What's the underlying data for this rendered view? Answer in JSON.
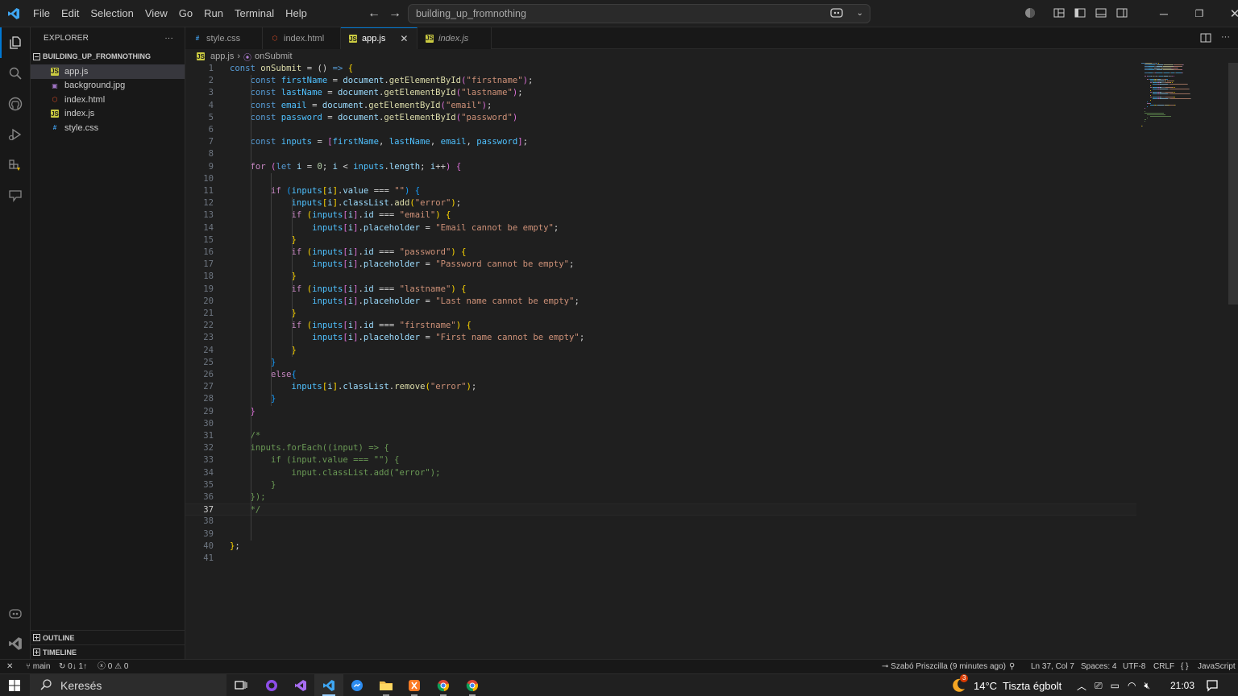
{
  "menu": [
    "File",
    "Edit",
    "Selection",
    "View",
    "Go",
    "Run",
    "Terminal",
    "Help"
  ],
  "command_center": {
    "text": "building_up_fromnothing"
  },
  "explorer": {
    "title": "EXPLORER",
    "more": "···",
    "root": "BUILDING_UP_FROMNOTHING",
    "files": [
      {
        "name": "app.js",
        "icon": "js"
      },
      {
        "name": "background.jpg",
        "icon": "image"
      },
      {
        "name": "index.html",
        "icon": "html"
      },
      {
        "name": "index.js",
        "icon": "js"
      },
      {
        "name": "style.css",
        "icon": "css"
      }
    ],
    "outline": "OUTLINE",
    "timeline": "TIMELINE"
  },
  "tabs": [
    {
      "label": "style.css",
      "icon": "css"
    },
    {
      "label": "index.html",
      "icon": "html"
    },
    {
      "label": "app.js",
      "icon": "js",
      "active": true
    },
    {
      "label": "index.js",
      "icon": "js",
      "preview": true
    }
  ],
  "breadcrumb": {
    "file": "app.js",
    "symbol": "onSubmit"
  },
  "editor": {
    "current_line": 37,
    "lines": [
      [
        [
          "kw",
          "const "
        ],
        [
          "fn",
          "onSubmit"
        ],
        [
          "pl",
          " = () "
        ],
        [
          "kw",
          "=>"
        ],
        [
          "pl",
          " "
        ],
        [
          "p1",
          "{"
        ]
      ],
      [
        [
          "pl",
          "    "
        ],
        [
          "kw",
          "const "
        ],
        [
          "cst",
          "firstName"
        ],
        [
          "pl",
          " = "
        ],
        [
          "var",
          "document"
        ],
        [
          "pl",
          "."
        ],
        [
          "fn",
          "getElementById"
        ],
        [
          "p2",
          "("
        ],
        [
          "str",
          "\"firstname\""
        ],
        [
          "p2",
          ")"
        ],
        [
          "pl",
          ";"
        ]
      ],
      [
        [
          "pl",
          "    "
        ],
        [
          "kw",
          "const "
        ],
        [
          "cst",
          "lastName"
        ],
        [
          "pl",
          " = "
        ],
        [
          "var",
          "document"
        ],
        [
          "pl",
          "."
        ],
        [
          "fn",
          "getElementById"
        ],
        [
          "p2",
          "("
        ],
        [
          "str",
          "\"lastname\""
        ],
        [
          "p2",
          ")"
        ],
        [
          "pl",
          ";"
        ]
      ],
      [
        [
          "pl",
          "    "
        ],
        [
          "kw",
          "const "
        ],
        [
          "cst",
          "email"
        ],
        [
          "pl",
          " = "
        ],
        [
          "var",
          "document"
        ],
        [
          "pl",
          "."
        ],
        [
          "fn",
          "getElementById"
        ],
        [
          "p2",
          "("
        ],
        [
          "str",
          "\"email\""
        ],
        [
          "p2",
          ")"
        ],
        [
          "pl",
          ";"
        ]
      ],
      [
        [
          "pl",
          "    "
        ],
        [
          "kw",
          "const "
        ],
        [
          "cst",
          "password"
        ],
        [
          "pl",
          " = "
        ],
        [
          "var",
          "document"
        ],
        [
          "pl",
          "."
        ],
        [
          "fn",
          "getElementById"
        ],
        [
          "p2",
          "("
        ],
        [
          "str",
          "\"password\""
        ],
        [
          "p2",
          ")"
        ]
      ],
      [],
      [
        [
          "pl",
          "    "
        ],
        [
          "kw",
          "const "
        ],
        [
          "cst",
          "inputs"
        ],
        [
          "pl",
          " = "
        ],
        [
          "p2",
          "["
        ],
        [
          "cst",
          "firstName"
        ],
        [
          "pl",
          ", "
        ],
        [
          "cst",
          "lastName"
        ],
        [
          "pl",
          ", "
        ],
        [
          "cst",
          "email"
        ],
        [
          "pl",
          ", "
        ],
        [
          "cst",
          "password"
        ],
        [
          "p2",
          "]"
        ],
        [
          "pl",
          ";"
        ]
      ],
      [],
      [
        [
          "pl",
          "    "
        ],
        [
          "ctl",
          "for"
        ],
        [
          "pl",
          " "
        ],
        [
          "p2",
          "("
        ],
        [
          "kw",
          "let "
        ],
        [
          "var",
          "i"
        ],
        [
          "pl",
          " = "
        ],
        [
          "num",
          "0"
        ],
        [
          "pl",
          "; "
        ],
        [
          "var",
          "i"
        ],
        [
          "pl",
          " < "
        ],
        [
          "cst",
          "inputs"
        ],
        [
          "pl",
          "."
        ],
        [
          "var",
          "length"
        ],
        [
          "pl",
          "; "
        ],
        [
          "var",
          "i"
        ],
        [
          "pl",
          "++"
        ],
        [
          "p2",
          ")"
        ],
        [
          "pl",
          " "
        ],
        [
          "p2",
          "{"
        ]
      ],
      [],
      [
        [
          "pl",
          "        "
        ],
        [
          "ctl",
          "if"
        ],
        [
          "pl",
          " "
        ],
        [
          "p3",
          "("
        ],
        [
          "cst",
          "inputs"
        ],
        [
          "p1",
          "["
        ],
        [
          "var",
          "i"
        ],
        [
          "p1",
          "]"
        ],
        [
          "pl",
          "."
        ],
        [
          "var",
          "value"
        ],
        [
          "pl",
          " === "
        ],
        [
          "str",
          "\"\""
        ],
        [
          "p3",
          ")"
        ],
        [
          "pl",
          " "
        ],
        [
          "p3",
          "{"
        ]
      ],
      [
        [
          "pl",
          "            "
        ],
        [
          "cst",
          "inputs"
        ],
        [
          "p1",
          "["
        ],
        [
          "var",
          "i"
        ],
        [
          "p1",
          "]"
        ],
        [
          "pl",
          "."
        ],
        [
          "var",
          "classList"
        ],
        [
          "pl",
          "."
        ],
        [
          "fn",
          "add"
        ],
        [
          "p1",
          "("
        ],
        [
          "str",
          "\"error\""
        ],
        [
          "p1",
          ")"
        ],
        [
          "pl",
          ";"
        ]
      ],
      [
        [
          "pl",
          "            "
        ],
        [
          "ctl",
          "if"
        ],
        [
          "pl",
          " "
        ],
        [
          "p1",
          "("
        ],
        [
          "cst",
          "inputs"
        ],
        [
          "p2",
          "["
        ],
        [
          "var",
          "i"
        ],
        [
          "p2",
          "]"
        ],
        [
          "pl",
          "."
        ],
        [
          "var",
          "id"
        ],
        [
          "pl",
          " === "
        ],
        [
          "str",
          "\"email\""
        ],
        [
          "p1",
          ")"
        ],
        [
          "pl",
          " "
        ],
        [
          "p1",
          "{"
        ]
      ],
      [
        [
          "pl",
          "                "
        ],
        [
          "cst",
          "inputs"
        ],
        [
          "p2",
          "["
        ],
        [
          "var",
          "i"
        ],
        [
          "p2",
          "]"
        ],
        [
          "pl",
          "."
        ],
        [
          "var",
          "placeholder"
        ],
        [
          "pl",
          " = "
        ],
        [
          "str",
          "\"Email cannot be empty\""
        ],
        [
          "pl",
          ";"
        ]
      ],
      [
        [
          "pl",
          "            "
        ],
        [
          "p1",
          "}"
        ]
      ],
      [
        [
          "pl",
          "            "
        ],
        [
          "ctl",
          "if"
        ],
        [
          "pl",
          " "
        ],
        [
          "p1",
          "("
        ],
        [
          "cst",
          "inputs"
        ],
        [
          "p2",
          "["
        ],
        [
          "var",
          "i"
        ],
        [
          "p2",
          "]"
        ],
        [
          "pl",
          "."
        ],
        [
          "var",
          "id"
        ],
        [
          "pl",
          " === "
        ],
        [
          "str",
          "\"password\""
        ],
        [
          "p1",
          ")"
        ],
        [
          "pl",
          " "
        ],
        [
          "p1",
          "{"
        ]
      ],
      [
        [
          "pl",
          "                "
        ],
        [
          "cst",
          "inputs"
        ],
        [
          "p2",
          "["
        ],
        [
          "var",
          "i"
        ],
        [
          "p2",
          "]"
        ],
        [
          "pl",
          "."
        ],
        [
          "var",
          "placeholder"
        ],
        [
          "pl",
          " = "
        ],
        [
          "str",
          "\"Password cannot be empty\""
        ],
        [
          "pl",
          ";"
        ]
      ],
      [
        [
          "pl",
          "            "
        ],
        [
          "p1",
          "}"
        ]
      ],
      [
        [
          "pl",
          "            "
        ],
        [
          "ctl",
          "if"
        ],
        [
          "pl",
          " "
        ],
        [
          "p1",
          "("
        ],
        [
          "cst",
          "inputs"
        ],
        [
          "p2",
          "["
        ],
        [
          "var",
          "i"
        ],
        [
          "p2",
          "]"
        ],
        [
          "pl",
          "."
        ],
        [
          "var",
          "id"
        ],
        [
          "pl",
          " === "
        ],
        [
          "str",
          "\"lastname\""
        ],
        [
          "p1",
          ")"
        ],
        [
          "pl",
          " "
        ],
        [
          "p1",
          "{"
        ]
      ],
      [
        [
          "pl",
          "                "
        ],
        [
          "cst",
          "inputs"
        ],
        [
          "p2",
          "["
        ],
        [
          "var",
          "i"
        ],
        [
          "p2",
          "]"
        ],
        [
          "pl",
          "."
        ],
        [
          "var",
          "placeholder"
        ],
        [
          "pl",
          " = "
        ],
        [
          "str",
          "\"Last name cannot be empty\""
        ],
        [
          "pl",
          ";"
        ]
      ],
      [
        [
          "pl",
          "            "
        ],
        [
          "p1",
          "}"
        ]
      ],
      [
        [
          "pl",
          "            "
        ],
        [
          "ctl",
          "if"
        ],
        [
          "pl",
          " "
        ],
        [
          "p1",
          "("
        ],
        [
          "cst",
          "inputs"
        ],
        [
          "p2",
          "["
        ],
        [
          "var",
          "i"
        ],
        [
          "p2",
          "]"
        ],
        [
          "pl",
          "."
        ],
        [
          "var",
          "id"
        ],
        [
          "pl",
          " === "
        ],
        [
          "str",
          "\"firstname\""
        ],
        [
          "p1",
          ")"
        ],
        [
          "pl",
          " "
        ],
        [
          "p1",
          "{"
        ]
      ],
      [
        [
          "pl",
          "                "
        ],
        [
          "cst",
          "inputs"
        ],
        [
          "p2",
          "["
        ],
        [
          "var",
          "i"
        ],
        [
          "p2",
          "]"
        ],
        [
          "pl",
          "."
        ],
        [
          "var",
          "placeholder"
        ],
        [
          "pl",
          " = "
        ],
        [
          "str",
          "\"First name cannot be empty\""
        ],
        [
          "pl",
          ";"
        ]
      ],
      [
        [
          "pl",
          "            "
        ],
        [
          "p1",
          "}"
        ]
      ],
      [
        [
          "pl",
          "        "
        ],
        [
          "p3",
          "}"
        ]
      ],
      [
        [
          "pl",
          "        "
        ],
        [
          "ctl",
          "else"
        ],
        [
          "p3",
          "{"
        ]
      ],
      [
        [
          "pl",
          "            "
        ],
        [
          "cst",
          "inputs"
        ],
        [
          "p1",
          "["
        ],
        [
          "var",
          "i"
        ],
        [
          "p1",
          "]"
        ],
        [
          "pl",
          "."
        ],
        [
          "var",
          "classList"
        ],
        [
          "pl",
          "."
        ],
        [
          "fn",
          "remove"
        ],
        [
          "p1",
          "("
        ],
        [
          "str",
          "\"error\""
        ],
        [
          "p1",
          ")"
        ],
        [
          "pl",
          ";"
        ]
      ],
      [
        [
          "pl",
          "        "
        ],
        [
          "p3",
          "}"
        ]
      ],
      [
        [
          "pl",
          "    "
        ],
        [
          "p2",
          "}"
        ]
      ],
      [],
      [
        [
          "pl",
          "    "
        ],
        [
          "cm",
          "/*"
        ]
      ],
      [
        [
          "pl",
          "    "
        ],
        [
          "cm",
          "inputs.forEach((input) => {"
        ]
      ],
      [
        [
          "pl",
          "        "
        ],
        [
          "cm",
          "if (input.value === \"\") {"
        ]
      ],
      [
        [
          "pl",
          "            "
        ],
        [
          "cm",
          "input.classList.add(\"error\");"
        ]
      ],
      [
        [
          "pl",
          "        "
        ],
        [
          "cm",
          "}"
        ]
      ],
      [
        [
          "pl",
          "    "
        ],
        [
          "cm",
          "});"
        ]
      ],
      [
        [
          "pl",
          "    "
        ],
        [
          "cm",
          "*/"
        ]
      ],
      [],
      [],
      [
        [
          "p1",
          "}"
        ],
        [
          "pl",
          ";"
        ]
      ],
      []
    ]
  },
  "status": {
    "branch": "main",
    "sync": "0↓ 1↑",
    "errors": "0",
    "warnings": "0",
    "blame": "Szabó Priszcilla (9 minutes ago)",
    "position": "Ln 37, Col 7",
    "spaces": "Spaces: 4",
    "encoding": "UTF-8",
    "eol": "CRLF",
    "language": "JavaScript"
  },
  "taskbar": {
    "search_text": "Keresés",
    "weather_badge": "3",
    "weather": "14°C  Tiszta égbolt",
    "time": "21:03"
  },
  "colors": {
    "accent": "#0078d4",
    "editor_bg": "#1f1f1f",
    "sidebar_bg": "#181818"
  }
}
